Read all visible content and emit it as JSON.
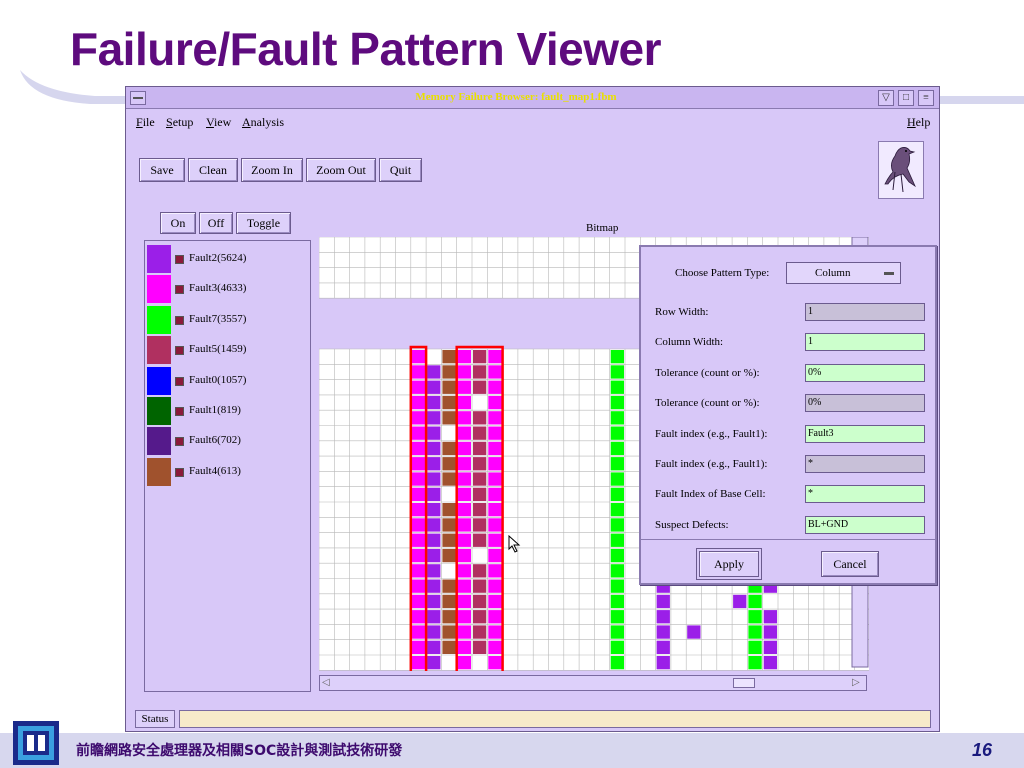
{
  "slide": {
    "title": "Failure/Fault Pattern Viewer",
    "footer_text": "前瞻網路安全處理器及相關SOC設計與測試技術研發",
    "page_number": "16"
  },
  "window": {
    "title": "Memory Failure Browser: fault_map1.fbm",
    "controls": [
      "▽",
      "□",
      "≡"
    ]
  },
  "menu": {
    "left": [
      {
        "label": "File",
        "mnemonic": "F",
        "rest": "ile"
      },
      {
        "label": "Setup",
        "mnemonic": "S",
        "rest": "etup"
      },
      {
        "label": "View",
        "mnemonic": "V",
        "rest": "iew"
      },
      {
        "label": "Analysis",
        "mnemonic": "A",
        "rest": "nalysis"
      }
    ],
    "help": {
      "label": "Help",
      "mnemonic": "H",
      "rest": "elp"
    }
  },
  "toolbar": {
    "save": "Save",
    "clean": "Clean",
    "zoom_in": "Zoom In",
    "zoom_out": "Zoom Out",
    "quit": "Quit"
  },
  "legend_controls": {
    "on": "On",
    "off": "Off",
    "toggle": "Toggle"
  },
  "legend": [
    {
      "label": "Fault2(5624)",
      "color": "#9b1fe8"
    },
    {
      "label": "Fault3(4633)",
      "color": "#ff00ff"
    },
    {
      "label": "Fault7(3557)",
      "color": "#00ff00"
    },
    {
      "label": "Fault5(1459)",
      "color": "#b03060"
    },
    {
      "label": "Fault0(1057)",
      "color": "#0000ff"
    },
    {
      "label": "Fault1(819)",
      "color": "#006400"
    },
    {
      "label": "Fault6(702)",
      "color": "#551a8b"
    },
    {
      "label": "Fault4(613)",
      "color": "#a0522d"
    }
  ],
  "bitmap": {
    "label": "Bitmap"
  },
  "dialog": {
    "pattern_type_label": "Choose Pattern Type:",
    "pattern_type_value": "Column",
    "fields": [
      {
        "label": "Row Width:",
        "value": "1",
        "active": false
      },
      {
        "label": "Column Width:",
        "value": "1",
        "active": true
      },
      {
        "label": "Tolerance (count or %):",
        "value": "0%",
        "active": true
      },
      {
        "label": "Tolerance (count or %):",
        "value": "0%",
        "active": false
      },
      {
        "label": "Fault index (e.g., Fault1):",
        "value": "Fault3",
        "active": true
      },
      {
        "label": "Fault index (e.g., Fault1):",
        "value": "*",
        "active": false
      },
      {
        "label": "Fault Index of Base Cell:",
        "value": "*",
        "active": true
      },
      {
        "label": "Suspect Defects:",
        "value": "BL+GND",
        "active": true
      }
    ],
    "apply": "Apply",
    "cancel": "Cancel"
  },
  "status": {
    "label": "Status",
    "value": ""
  }
}
